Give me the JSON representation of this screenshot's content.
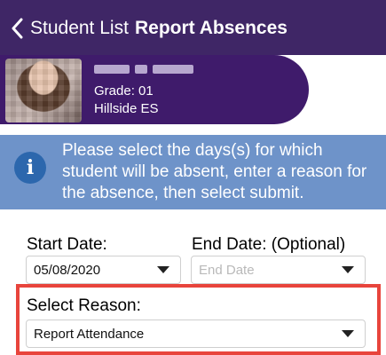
{
  "nav": {
    "back_label": "Student List",
    "title": "Report Absences",
    "back_icon": "chevron-left-icon"
  },
  "student": {
    "grade": "Grade: 01",
    "school": "Hillside ES"
  },
  "notice": {
    "text": "Please select the days(s) for which student will be absent, enter a reason for the absence, then select submit.",
    "icon": "info-icon"
  },
  "form": {
    "start_date_label": "Start Date:",
    "start_date_value": "05/08/2020",
    "end_date_label": "End Date: (Optional)",
    "end_date_placeholder": "End Date",
    "reason_label": "Select Reason:",
    "reason_value": "Report Attendance"
  },
  "colors": {
    "nav": "#3f2666",
    "card": "#3f1b6b",
    "notice": "#6e93c9",
    "highlight": "#e8443c"
  }
}
